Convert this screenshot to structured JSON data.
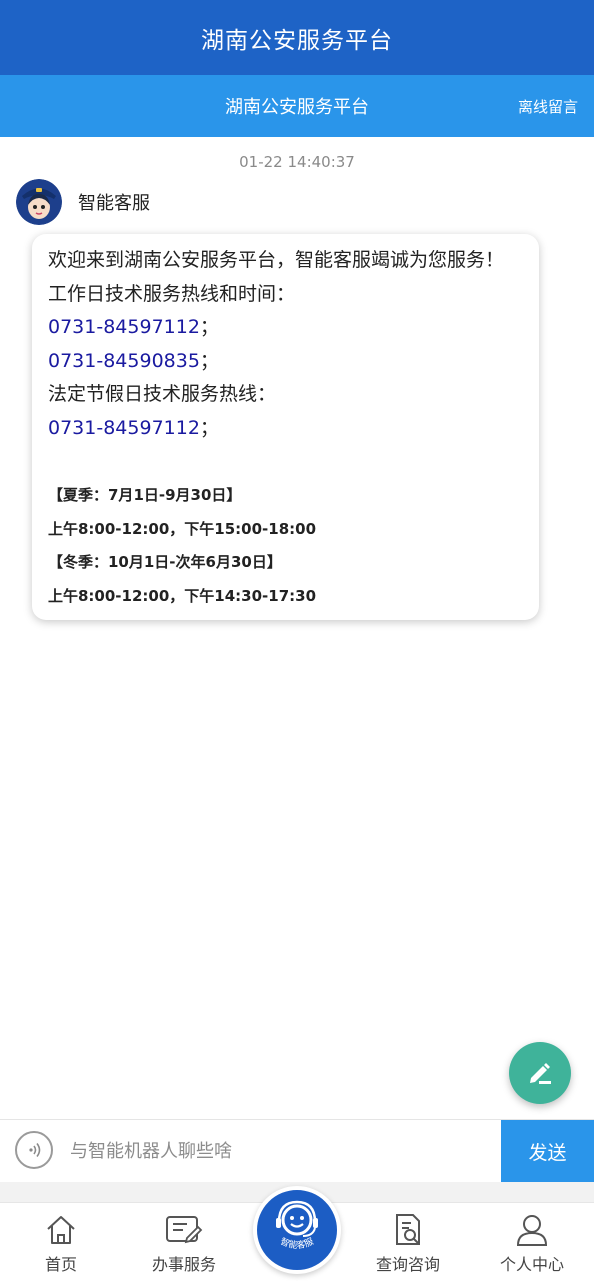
{
  "header": {
    "title": "湖南公安服务平台"
  },
  "subheader": {
    "title": "湖南公安服务平台",
    "offline_message": "离线留言"
  },
  "chat": {
    "timestamp": "01-22 14:40:37",
    "agent_name": "智能客服",
    "message": {
      "welcome": "欢迎来到湖南公安服务平台，智能客服竭诚为您服务！",
      "workday_label": "工作日技术服务热线和时间：",
      "workday_phones": [
        "0731-84597112",
        "0731-84590835"
      ],
      "holiday_label": "法定节假日技术服务热线：",
      "holiday_phone": "0731-84597112",
      "phone_suffix": "；",
      "summer_label": "【夏季：7月1日-9月30日】",
      "summer_hours": "上午8:00-12:00，下午15:00-18:00",
      "winter_label": "【冬季：10月1日-次年6月30日】",
      "winter_hours": "上午8:00-12:00，下午14:30-17:30"
    }
  },
  "input": {
    "placeholder": "与智能机器人聊些啥",
    "value": "",
    "send_label": "发送"
  },
  "tabbar": {
    "items": [
      {
        "label": "首页",
        "icon": "home-icon"
      },
      {
        "label": "办事服务",
        "icon": "document-edit-icon"
      },
      {
        "label": "查询咨询",
        "icon": "document-search-icon"
      },
      {
        "label": "个人中心",
        "icon": "user-icon"
      }
    ],
    "center_badge": "智能客服"
  },
  "colors": {
    "header": "#1e63c6",
    "subheader": "#2a95ea",
    "phone_link": "#1a1aa0",
    "fab": "#3fb39a",
    "send": "#2a95ea"
  }
}
